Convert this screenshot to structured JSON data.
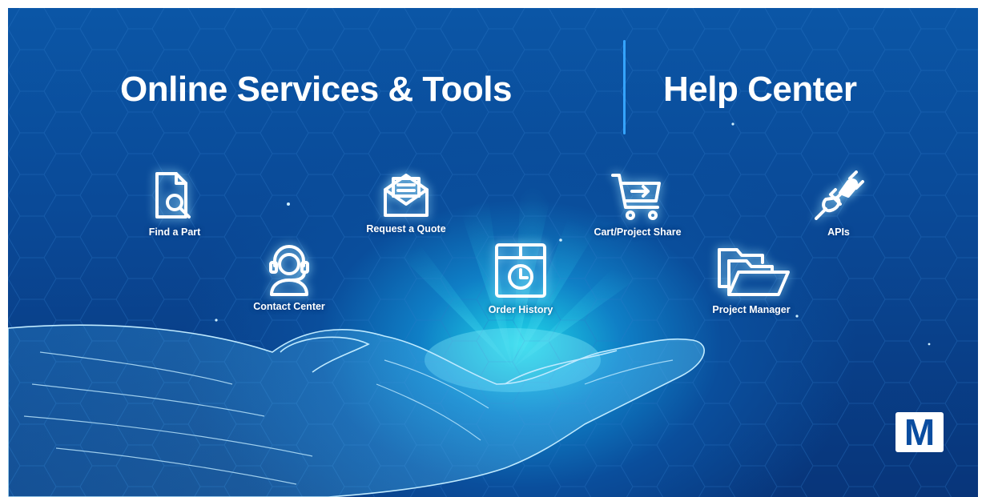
{
  "header": {
    "left_title": "Online Services & Tools",
    "right_title": "Help Center"
  },
  "tiles": [
    {
      "label": "Find a Part",
      "icon": "find-part-icon"
    },
    {
      "label": "Contact Center",
      "icon": "headset-icon"
    },
    {
      "label": "Request a Quote",
      "icon": "envelope-icon"
    },
    {
      "label": "Order History",
      "icon": "box-clock-icon"
    },
    {
      "label": "Cart/Project Share",
      "icon": "cart-icon"
    },
    {
      "label": "Project Manager",
      "icon": "folders-icon"
    },
    {
      "label": "APIs",
      "icon": "plug-icon"
    }
  ],
  "logo": {
    "letter": "M"
  },
  "colors": {
    "background": "#0a4a98",
    "glow": "#1fd6e8",
    "divider": "#35a4ff",
    "text": "#ffffff"
  }
}
